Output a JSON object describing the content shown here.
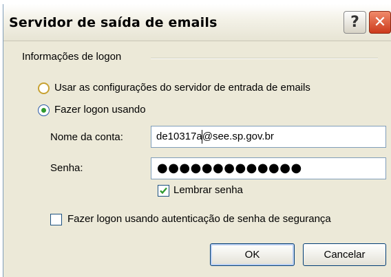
{
  "window": {
    "title": "Servidor de saída de emails",
    "help_icon": "question-mark-icon",
    "close_icon": "close-x-icon",
    "help_glyph": "?",
    "close_glyph": "✕"
  },
  "group": {
    "label": "Informações de logon"
  },
  "options": {
    "use_incoming": {
      "label": "Usar as configurações do servidor de entrada de emails",
      "selected": false
    },
    "login_using": {
      "label": "Fazer logon usando",
      "selected": true
    }
  },
  "account": {
    "label": "Nome da conta:",
    "value": "de10317a@see.sp.gov.br"
  },
  "password": {
    "label": "Senha:",
    "masked_value": "●●●●●●●●●●●●●"
  },
  "remember_password": {
    "label": "Lembrar senha",
    "checked": true
  },
  "secure_auth": {
    "label": "Fazer logon usando autenticação de senha de segurança",
    "checked": false
  },
  "buttons": {
    "ok": "OK",
    "cancel": "Cancelar"
  },
  "colors": {
    "dialog_bg": "#ece9d8",
    "close_button": "#cc3a1c",
    "focus_border": "#003c74",
    "check_green": "#2f9a2f"
  }
}
